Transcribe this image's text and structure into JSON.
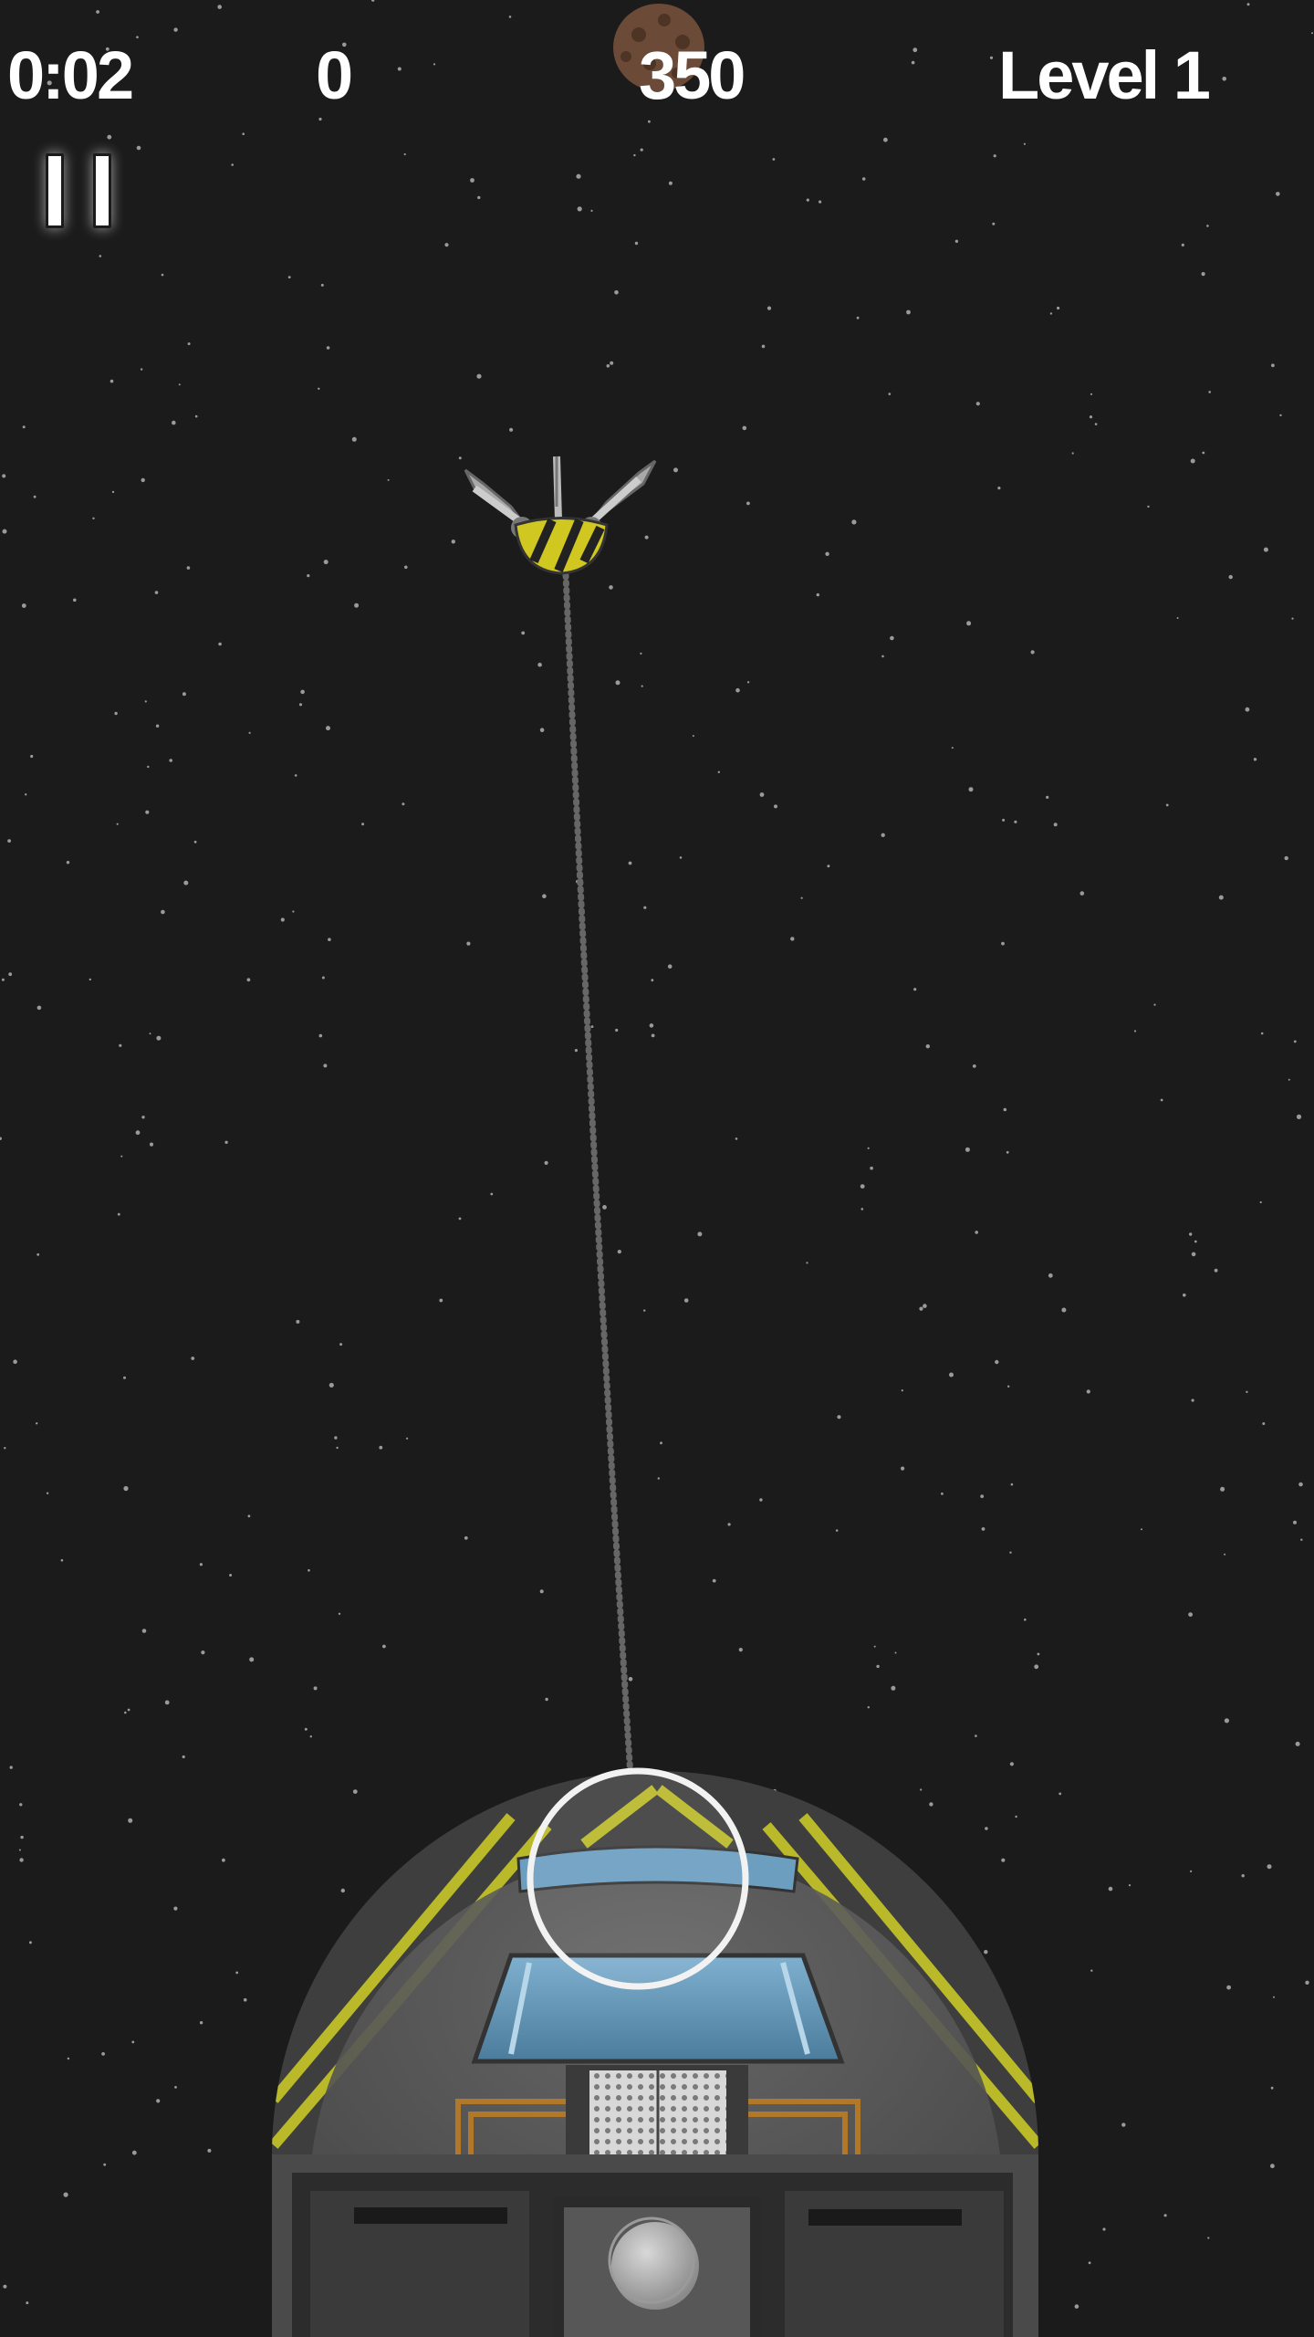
{
  "hud": {
    "time": "0:02",
    "score": "0",
    "target_score": "350",
    "level": "Level 1"
  },
  "controls": {
    "pause_icon": "pause-icon"
  },
  "objects": {
    "asteroid": "asteroid",
    "claw": "grabber-claw",
    "tether": "dotted-tether",
    "base": "space-station-dome",
    "aim": "aim-reticle"
  },
  "colors": {
    "background": "#1b1b1b",
    "hazard_yellow": "#c8c828",
    "dome_gray": "#5a5a5a",
    "window_blue": "#5a8fb0",
    "asteroid_brown": "#6b4a38",
    "text": "#ffffff"
  }
}
